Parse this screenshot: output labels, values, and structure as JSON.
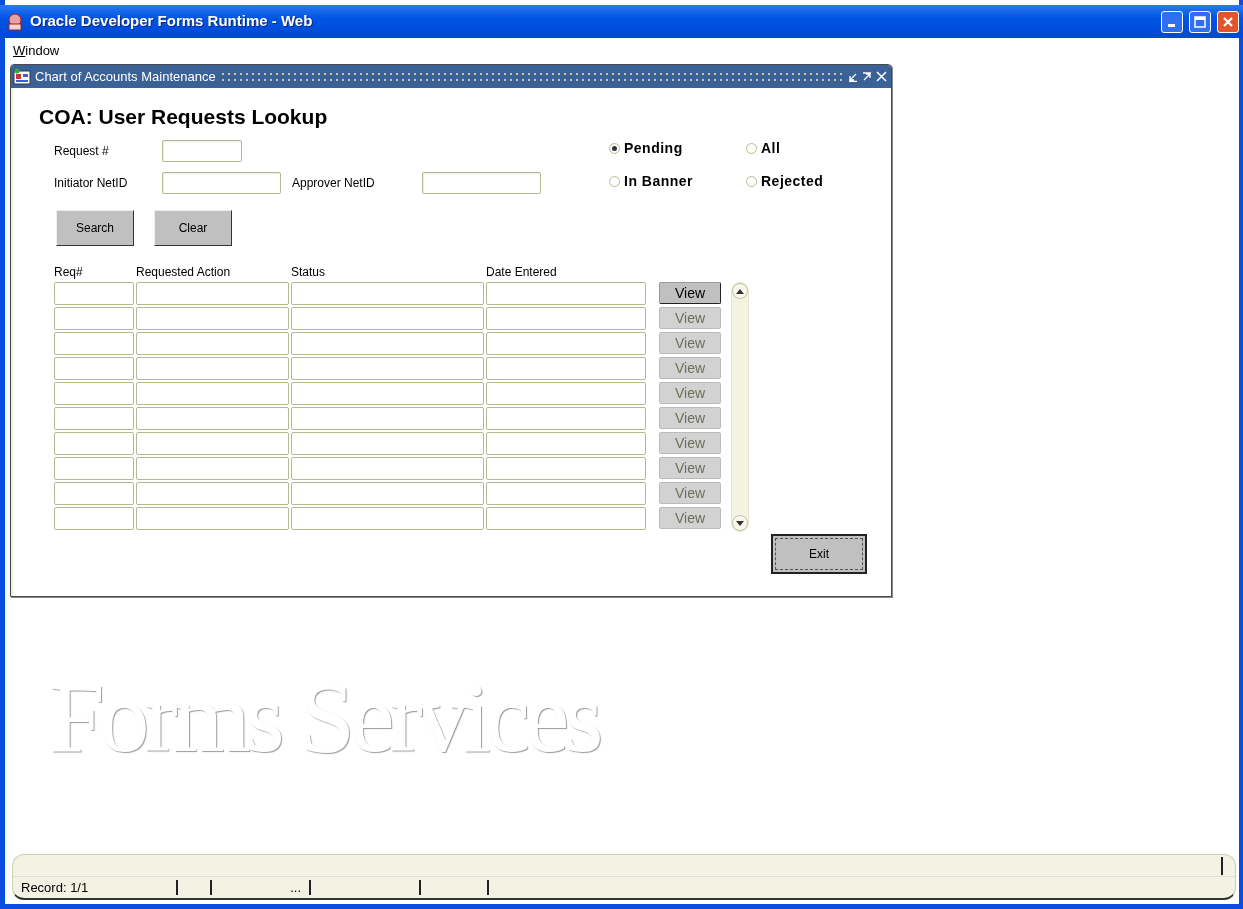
{
  "window": {
    "title": "Oracle Developer Forms Runtime - Web"
  },
  "menu": [
    {
      "label": "Window"
    }
  ],
  "form": {
    "title": "Chart of Accounts Maintenance",
    "heading": "COA: User Requests Lookup",
    "fields": [
      {
        "label": "Request #",
        "kind": "short"
      },
      {
        "label": "Initiator NetID",
        "kind": "long"
      },
      {
        "label": "Approver NetID",
        "kind": "long"
      }
    ],
    "status_filter": [
      {
        "label": "Pending",
        "selected": true
      },
      {
        "label": "All",
        "selected": false
      },
      {
        "label": "In Banner",
        "selected": false
      },
      {
        "label": "Rejected",
        "selected": false
      }
    ],
    "buttons": [
      "Search",
      "Clear"
    ],
    "results": {
      "columns": [
        "Req#",
        "Requested Action",
        "Status",
        "Date Entered"
      ],
      "rows": [
        {
          "button": "View",
          "disabled": false
        },
        {
          "button": "View",
          "disabled": true
        },
        {
          "button": "View",
          "disabled": true
        },
        {
          "button": "View",
          "disabled": true
        },
        {
          "button": "View",
          "disabled": true
        },
        {
          "button": "View",
          "disabled": true
        },
        {
          "button": "View",
          "disabled": true
        },
        {
          "button": "View",
          "disabled": true
        },
        {
          "button": "View",
          "disabled": true
        },
        {
          "button": "View",
          "disabled": true
        }
      ]
    },
    "exit_button": "Exit"
  },
  "background_logo": "Forms Services",
  "status_bar": {
    "record": "Record: 1/1",
    "ellipsis": "..."
  }
}
